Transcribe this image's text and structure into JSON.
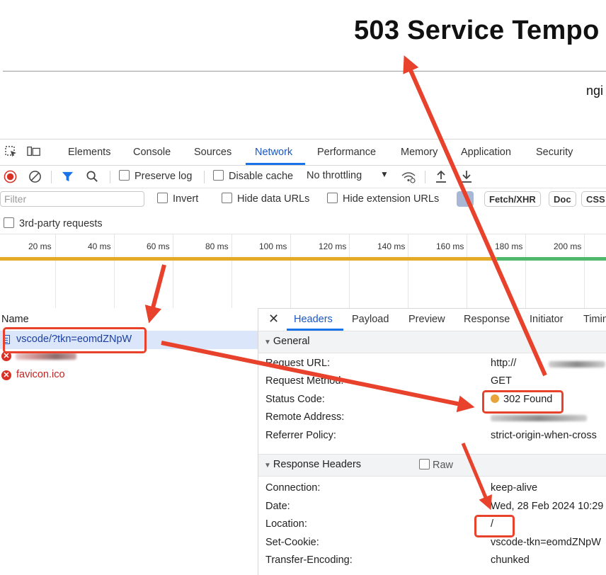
{
  "page": {
    "title": "503 Service Tempo",
    "footer": "ngi"
  },
  "devtools": {
    "tabs": [
      "Elements",
      "Console",
      "Sources",
      "Network",
      "Performance",
      "Memory",
      "Application",
      "Security"
    ],
    "active_tab": "Network",
    "toolbar": {
      "preserve_log": "Preserve log",
      "disable_cache": "Disable cache",
      "throttling": "No throttling"
    },
    "filter": {
      "placeholder": "Filter",
      "invert": "Invert",
      "hide_data_urls": "Hide data URLs",
      "hide_extension_urls": "Hide extension URLs",
      "chips": [
        "Fetch/XHR",
        "Doc",
        "CSS"
      ]
    },
    "third_party": "3rd-party requests",
    "timeline_ticks": [
      "20 ms",
      "40 ms",
      "60 ms",
      "80 ms",
      "100 ms",
      "120 ms",
      "140 ms",
      "160 ms",
      "180 ms",
      "200 ms"
    ],
    "requests": {
      "header": "Name",
      "rows": [
        {
          "name": "vscode/?tkn=eomdZNpW",
          "status": "selected"
        },
        {
          "name": "",
          "status": "error"
        },
        {
          "name": "favicon.ico",
          "status": "error"
        }
      ]
    },
    "details": {
      "close": "✕",
      "tabs": [
        "Headers",
        "Payload",
        "Preview",
        "Response",
        "Initiator",
        "Timin"
      ],
      "active_tab": "Headers",
      "general": {
        "title": "General",
        "rows": [
          {
            "key": "Request URL:",
            "value": "http://"
          },
          {
            "key": "Request Method:",
            "value": "GET"
          },
          {
            "key": "Status Code:",
            "value": "302 Found"
          },
          {
            "key": "Remote Address:",
            "value": ""
          },
          {
            "key": "Referrer Policy:",
            "value": "strict-origin-when-cross"
          }
        ]
      },
      "response_headers": {
        "title": "Response Headers",
        "raw": "Raw",
        "rows": [
          {
            "key": "Connection:",
            "value": "keep-alive"
          },
          {
            "key": "Date:",
            "value": "Wed, 28 Feb 2024 10:29"
          },
          {
            "key": "Location:",
            "value": "/"
          },
          {
            "key": "Set-Cookie:",
            "value": "vscode-tkn=eomdZNpW"
          },
          {
            "key": "Transfer-Encoding:",
            "value": "chunked"
          }
        ]
      }
    }
  },
  "colors": {
    "annotation": "#e8412c",
    "accent": "#1a73e8",
    "status_dot": "#e8a33a",
    "error": "#d93025"
  }
}
